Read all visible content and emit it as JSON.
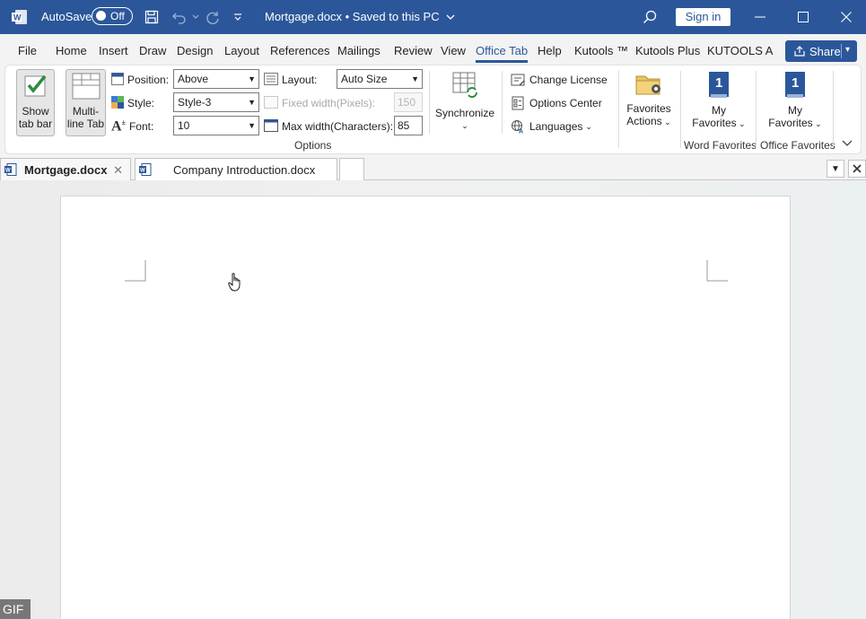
{
  "titlebar": {
    "autosave_label": "AutoSave",
    "autosave_state": "Off",
    "document_title": "Mortgage.docx • Saved to this PC",
    "sign_in": "Sign in"
  },
  "menu": {
    "tabs": [
      "File",
      "Home",
      "Insert",
      "Draw",
      "Design",
      "Layout",
      "References",
      "Mailings",
      "Review",
      "View",
      "Office Tab",
      "Help",
      "Kutools ™",
      "Kutools Plus",
      "KUTOOLS A"
    ],
    "active": "Office Tab",
    "share": "Share"
  },
  "ribbon": {
    "show_tab_bar": [
      "Show",
      "tab bar"
    ],
    "multi_line_tab": [
      "Multi-",
      "line Tab"
    ],
    "position_label": "Position:",
    "position_value": "Above",
    "style_label": "Style:",
    "style_value": "Style-3",
    "font_label": "Font:",
    "font_value": "10",
    "layout_label": "Layout:",
    "layout_value": "Auto Size",
    "fixed_width_label": "Fixed width(Pixels):",
    "fixed_width_value": "150",
    "max_width_label": "Max width(Characters):",
    "max_width_value": "85",
    "options_group": "Options",
    "synchronize": "Synchronize",
    "change_license": "Change License",
    "options_center": "Options Center",
    "languages": "Languages",
    "favorites_actions": [
      "Favorites",
      "Actions"
    ],
    "my_favorites_word": [
      "My",
      "Favorites"
    ],
    "my_favorites_office": [
      "My",
      "Favorites"
    ],
    "word_favorites_group": "Word Favorites",
    "office_favorites_group": "Office Favorites",
    "fav_badge": "1"
  },
  "doc_tabs": [
    {
      "label": "Mortgage.docx",
      "active": true
    },
    {
      "label": "Company Introduction.docx",
      "active": false
    }
  ],
  "overlay": {
    "gif_label": "GIF"
  },
  "colors": {
    "accent": "#2b579a"
  }
}
